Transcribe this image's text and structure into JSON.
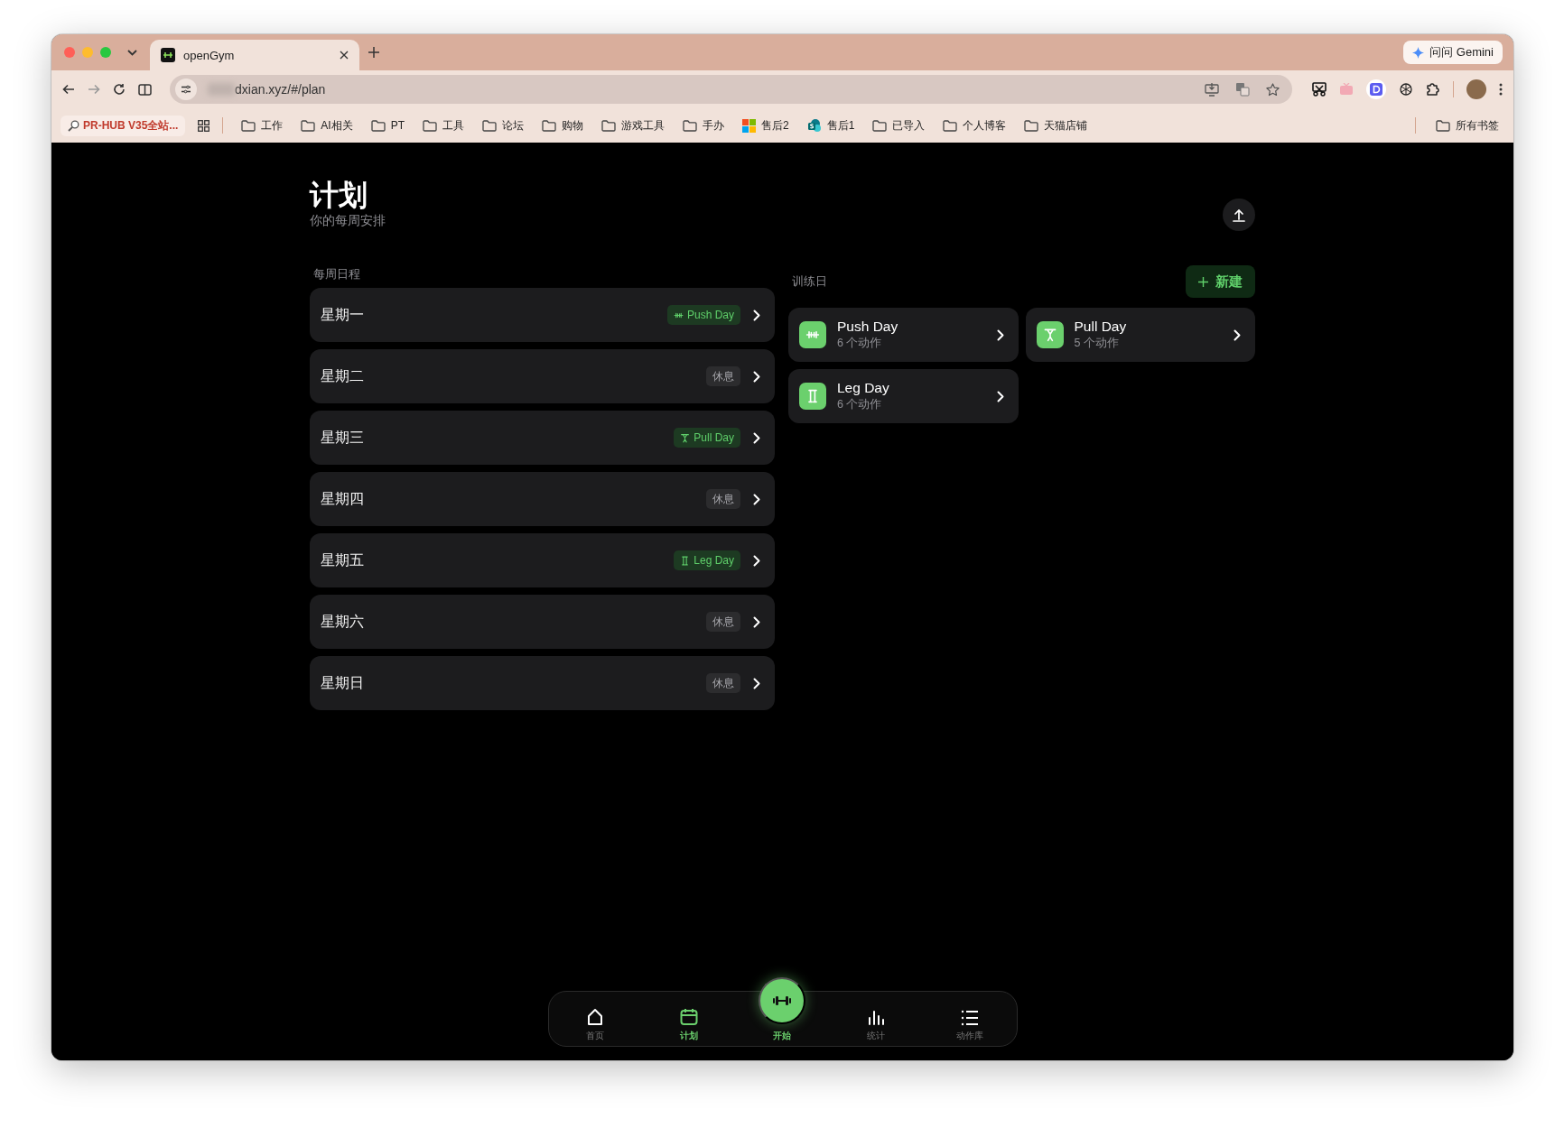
{
  "browser": {
    "tab": {
      "title": "openGym",
      "selected": true
    },
    "gemini_button": "问问 Gemini",
    "url": "dxian.xyz/#/plan",
    "pinned_bookmark": "PR-HUB V35全站...",
    "bookmarks": [
      {
        "kind": "folder",
        "label": "工作"
      },
      {
        "kind": "folder",
        "label": "AI相关"
      },
      {
        "kind": "folder",
        "label": "PT"
      },
      {
        "kind": "folder",
        "label": "工具"
      },
      {
        "kind": "folder",
        "label": "论坛"
      },
      {
        "kind": "folder",
        "label": "购物"
      },
      {
        "kind": "folder",
        "label": "游戏工具"
      },
      {
        "kind": "folder",
        "label": "手办"
      },
      {
        "kind": "tiles",
        "label": "售后2"
      },
      {
        "kind": "site",
        "label": "售后1"
      },
      {
        "kind": "folder",
        "label": "已导入"
      },
      {
        "kind": "folder",
        "label": "个人博客"
      },
      {
        "kind": "folder",
        "label": "天猫店铺"
      }
    ],
    "all_bookmarks": "所有书签"
  },
  "page": {
    "title": "计划",
    "subtitle": "你的每周安排"
  },
  "schedule": {
    "heading": "每周日程",
    "days": [
      {
        "day": "星期一",
        "kind": "push",
        "tag": "Push Day"
      },
      {
        "day": "星期二",
        "kind": "rest",
        "tag": "休息"
      },
      {
        "day": "星期三",
        "kind": "pull",
        "tag": "Pull Day"
      },
      {
        "day": "星期四",
        "kind": "rest",
        "tag": "休息"
      },
      {
        "day": "星期五",
        "kind": "leg",
        "tag": "Leg Day"
      },
      {
        "day": "星期六",
        "kind": "rest",
        "tag": "休息"
      },
      {
        "day": "星期日",
        "kind": "rest",
        "tag": "休息"
      }
    ]
  },
  "workouts": {
    "heading": "训练日",
    "new_button": "新建",
    "items": [
      {
        "kind": "push",
        "name": "Push Day",
        "count": "6 个动作"
      },
      {
        "kind": "pull",
        "name": "Pull Day",
        "count": "5 个动作"
      },
      {
        "kind": "leg",
        "name": "Leg Day",
        "count": "6 个动作"
      }
    ]
  },
  "nav": [
    {
      "kind": "home",
      "label": "首页",
      "selected": false
    },
    {
      "kind": "plan",
      "label": "计划",
      "selected": true
    },
    {
      "kind": "start",
      "label": "开始",
      "selected": false
    },
    {
      "kind": "stats",
      "label": "统计",
      "selected": false
    },
    {
      "kind": "library",
      "label": "动作库",
      "selected": false
    }
  ]
}
